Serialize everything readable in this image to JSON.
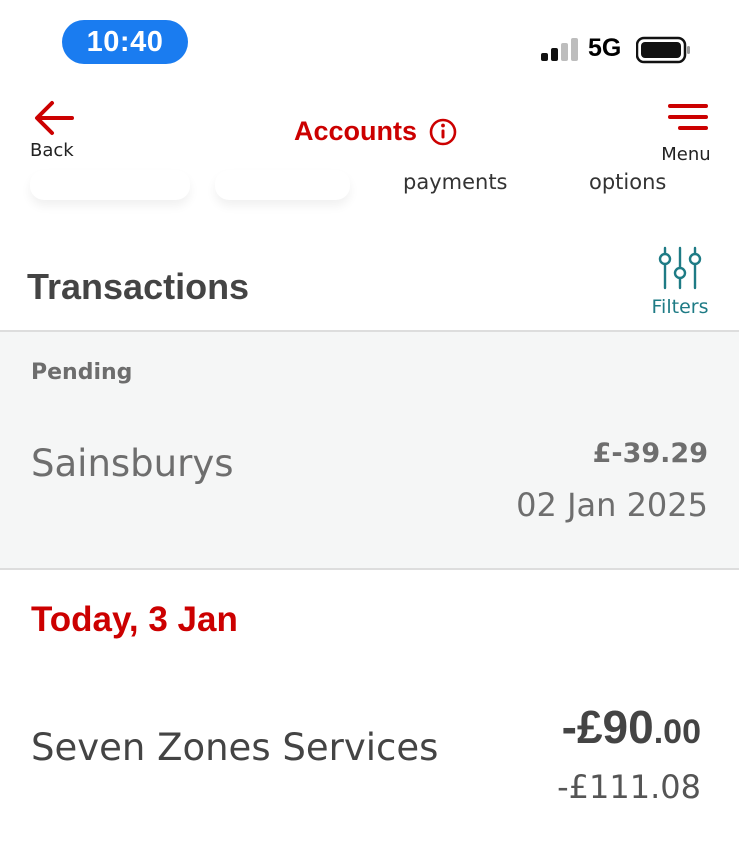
{
  "status_bar": {
    "time": "10:40",
    "network": "5G",
    "signal_bars_filled": 2,
    "signal_bars_total": 4
  },
  "nav": {
    "back_label": "Back",
    "title": "Accounts",
    "menu_label": "Menu",
    "accent_color": "#cc0000"
  },
  "quick_actions": {
    "items": [
      {
        "label": "payments"
      },
      {
        "label": "options"
      }
    ]
  },
  "transactions": {
    "title": "Transactions",
    "filters_label": "Filters",
    "filters_color": "#1e7b85"
  },
  "pending": {
    "label": "Pending",
    "items": [
      {
        "merchant": "Sainsburys",
        "amount": "£-39.29",
        "date": "02 Jan 2025"
      }
    ]
  },
  "today": {
    "label": "Today, 3 Jan",
    "items": [
      {
        "merchant": "Seven Zones Services",
        "amount_main": "-£90",
        "amount_pence": ".00",
        "balance": "-£111.08"
      }
    ]
  }
}
